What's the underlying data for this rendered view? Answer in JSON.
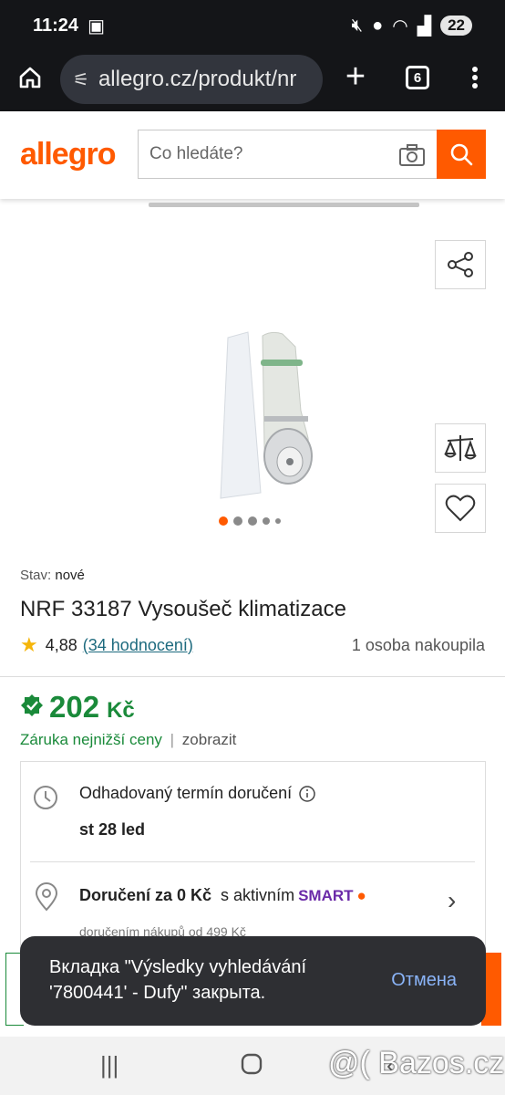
{
  "status_bar": {
    "time": "11:24",
    "battery": "22"
  },
  "browser": {
    "url": "allegro.cz/produkt/nr",
    "tab_count": "6"
  },
  "header": {
    "logo": "allegro",
    "search_placeholder": "Co hledáte?"
  },
  "product": {
    "condition_label": "Stav:",
    "condition_value": "nové",
    "title": "NRF 33187 Vysoušeč klimatizace",
    "rating_value": "4,88",
    "rating_link": "(34 hodnocení)",
    "purchased": "1 osoba nakoupila",
    "image_count": 5,
    "active_image": 1
  },
  "price": {
    "value": "202",
    "currency": "Kč",
    "guarantee": "Záruka nejnižší ceny",
    "separator": "|",
    "show": "zobrazit"
  },
  "delivery": {
    "estimate_label": "Odhadovaný termín doručení",
    "estimate_date": "st 28 led",
    "free_label": "Doručení za 0 Kč",
    "with_active": "s aktivním",
    "smart": "SMART",
    "condition": "doručením nákupů od 499 Kč"
  },
  "toast": {
    "message_line1": "Вкладка \"Výsledky vyhledávání",
    "message_line2": "'7800441' - Dufy\" закрыта.",
    "action": "Отмена"
  },
  "watermark": "@( Bazos.cz",
  "colors": {
    "brand": "#ff5a00",
    "price": "#1a8a3a",
    "link": "#1d6a7e",
    "smart": "#6b2aa8"
  }
}
